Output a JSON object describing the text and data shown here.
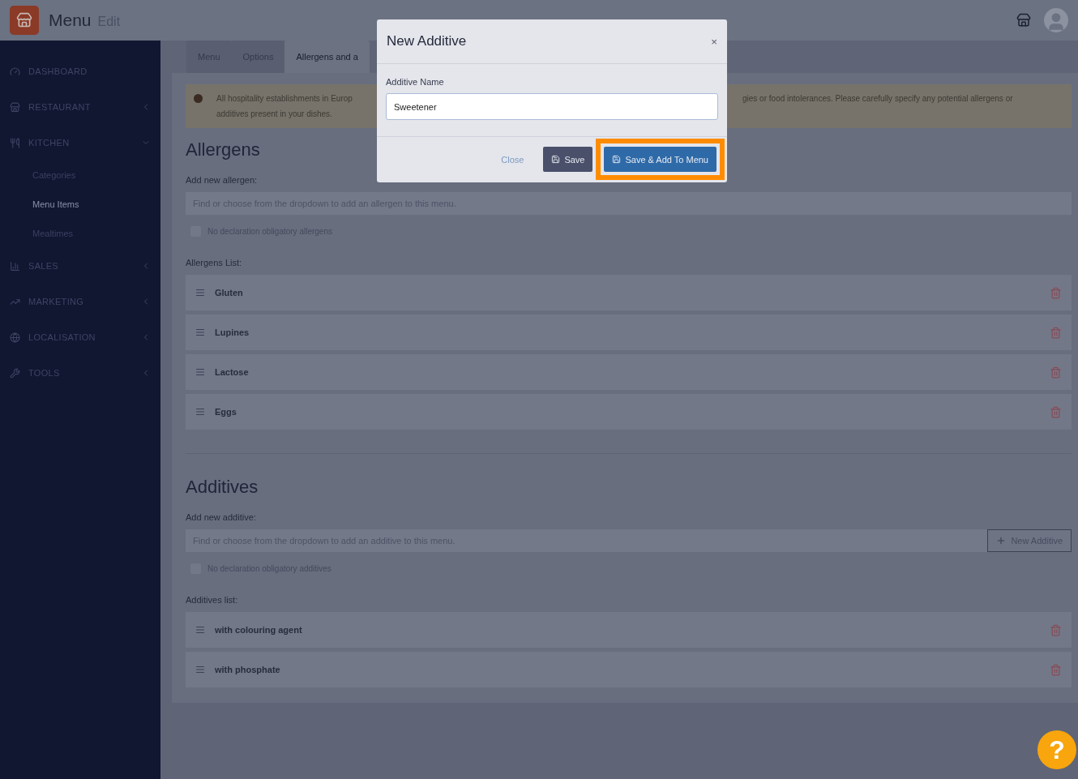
{
  "header": {
    "title": "Menu",
    "subtitle": "Edit"
  },
  "sidebar": {
    "items": [
      {
        "label": "DASHBOARD",
        "kind": "link"
      },
      {
        "label": "RESTAURANT",
        "kind": "group",
        "expanded": false
      },
      {
        "label": "KITCHEN",
        "kind": "group",
        "expanded": true,
        "children": [
          {
            "label": "Categories",
            "selected": false
          },
          {
            "label": "Menu Items",
            "selected": true
          },
          {
            "label": "Mealtimes",
            "selected": false
          }
        ]
      },
      {
        "label": "SALES",
        "kind": "group",
        "expanded": false
      },
      {
        "label": "MARKETING",
        "kind": "group",
        "expanded": false
      },
      {
        "label": "LOCALISATION",
        "kind": "group",
        "expanded": false
      },
      {
        "label": "TOOLS",
        "kind": "group",
        "expanded": false
      }
    ]
  },
  "tabs": [
    {
      "label": "Menu",
      "selected": false
    },
    {
      "label": "Options",
      "selected": false
    },
    {
      "label": "Allergens and a",
      "selected": true
    }
  ],
  "notice": {
    "left_lines": [
      "All hospitality establishments in Europ",
      "additives present in your dishes."
    ],
    "right_line": "gies or food intolerances. Please carefully specify any potential allergens or"
  },
  "allergens": {
    "title": "Allergens",
    "add_label": "Add new allergen:",
    "placeholder": "Find or choose from the dropdown to add an allergen to this menu.",
    "checkbox": {
      "label": "No declaration obligatory allergens",
      "checked": false
    },
    "list_label": "Allergens List:",
    "items": [
      "Gluten",
      "Lupines",
      "Lactose",
      "Eggs"
    ]
  },
  "additives": {
    "title": "Additives",
    "add_label": "Add new additive:",
    "placeholder": "Find or choose from the dropdown to add an additive to this menu.",
    "new_button": "New Additive",
    "checkbox": {
      "label": "No declaration obligatory additives",
      "checked": false
    },
    "list_label": "Additives list:",
    "items": [
      "with colouring agent",
      "with phosphate"
    ]
  },
  "modal": {
    "title": "New Additive",
    "close_symbol": "×",
    "field_label": "Additive Name",
    "value": "Sweetener",
    "buttons": [
      {
        "label": "Close",
        "kind": "link",
        "highlighted": false
      },
      {
        "label": "Save",
        "kind": "dark",
        "highlighted": false
      },
      {
        "label": "Save & Add To Menu",
        "kind": "primary",
        "highlighted": true
      }
    ]
  },
  "help_button": "?"
}
